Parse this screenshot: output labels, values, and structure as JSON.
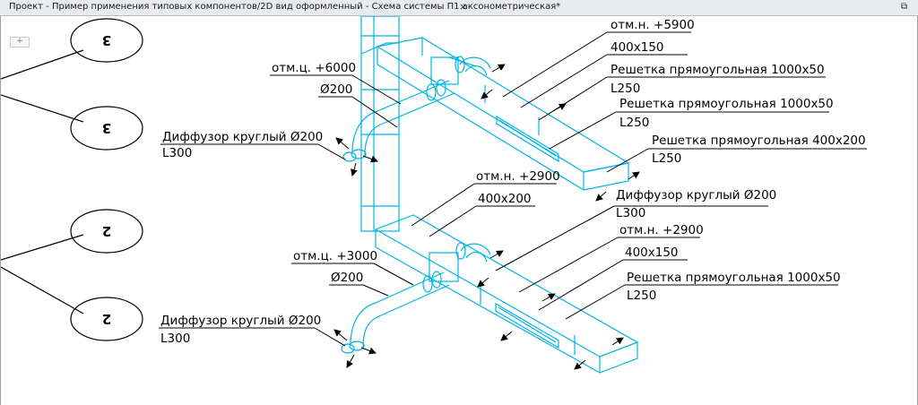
{
  "window": {
    "title": "Проект - Пример применения типовых компонентов/2D вид оформленный - Схема системы П1 аксонометрическая*",
    "close_glyph": "×",
    "restore_glyph": "⧉",
    "add_glyph": "+"
  },
  "colors": {
    "duct": "#00b4e6",
    "text": "#000000",
    "background": "#ffffff"
  },
  "markers": [
    "3",
    "3",
    "2",
    "2"
  ],
  "labels": {
    "l1_a": "отм.н. +5900",
    "l1_b": "400x150",
    "l1_c": "Решетка прямоугольная 1000x50",
    "l1_d": "L250",
    "l1_e": "Решетка прямоугольная 1000x50",
    "l1_f": "L250",
    "l1_g": "Решетка прямоугольная 400x200",
    "l1_h": "L250",
    "l1_i": "отм.ц. +6000",
    "l1_j": "Ø200",
    "l1_k": "Диффузор круглый Ø200",
    "l1_l": "L300",
    "l2_a": "отм.н. +2900",
    "l2_b": "400x200",
    "l2_c": "Диффузор круглый Ø200",
    "l2_d": "L300",
    "l2_e": "отм.н. +2900",
    "l2_f": "400x150",
    "l2_g": "Решетка прямоугольная 1000x50",
    "l2_h": "L250",
    "l2_i": "отм.ц. +3000",
    "l2_j": "Ø200",
    "l2_k": "Диффузор круглый Ø200",
    "l2_l": "L300"
  }
}
